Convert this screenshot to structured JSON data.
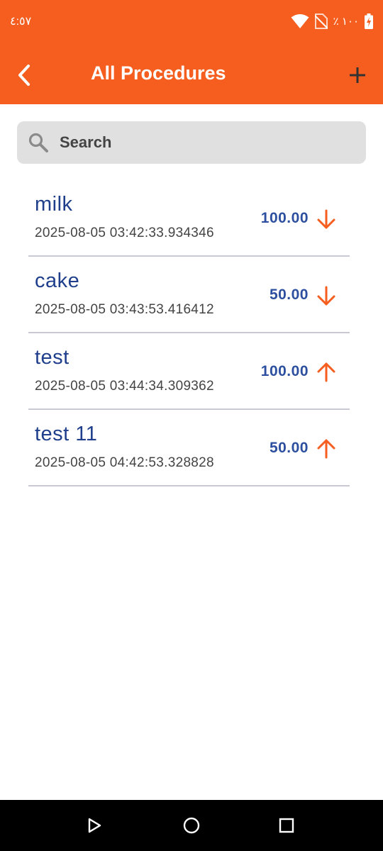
{
  "status_bar": {
    "time": "٤:٥٧",
    "battery_text": "٪ ١٠٠",
    "icons": [
      "wifi-icon",
      "no-sim-icon",
      "battery-charging-icon"
    ]
  },
  "app_bar": {
    "title": "All Procedures",
    "back_icon": "chevron-left-icon",
    "add_icon": "plus-icon",
    "background_color": "#F55E1E"
  },
  "search": {
    "placeholder": "Search",
    "value": "",
    "icon": "search-icon"
  },
  "procedures": [
    {
      "name": "milk",
      "date": "2025-08-05 03:42:33.934346",
      "amount": "100.00",
      "direction": "down"
    },
    {
      "name": "cake",
      "date": "2025-08-05 03:43:53.416412",
      "amount": "50.00",
      "direction": "down"
    },
    {
      "name": "test",
      "date": "2025-08-05 03:44:34.309362",
      "amount": "100.00",
      "direction": "up"
    },
    {
      "name": "test 11",
      "date": "2025-08-05 04:42:53.328828",
      "amount": "50.00",
      "direction": "up"
    }
  ],
  "nav_bar": {
    "buttons": [
      "back-triangle-icon",
      "home-circle-icon",
      "recents-square-icon"
    ]
  },
  "colors": {
    "accent": "#F55E1E",
    "name_text": "#1F3F8C",
    "amount_text": "#2D4FA0",
    "divider": "#C9C9D3"
  }
}
